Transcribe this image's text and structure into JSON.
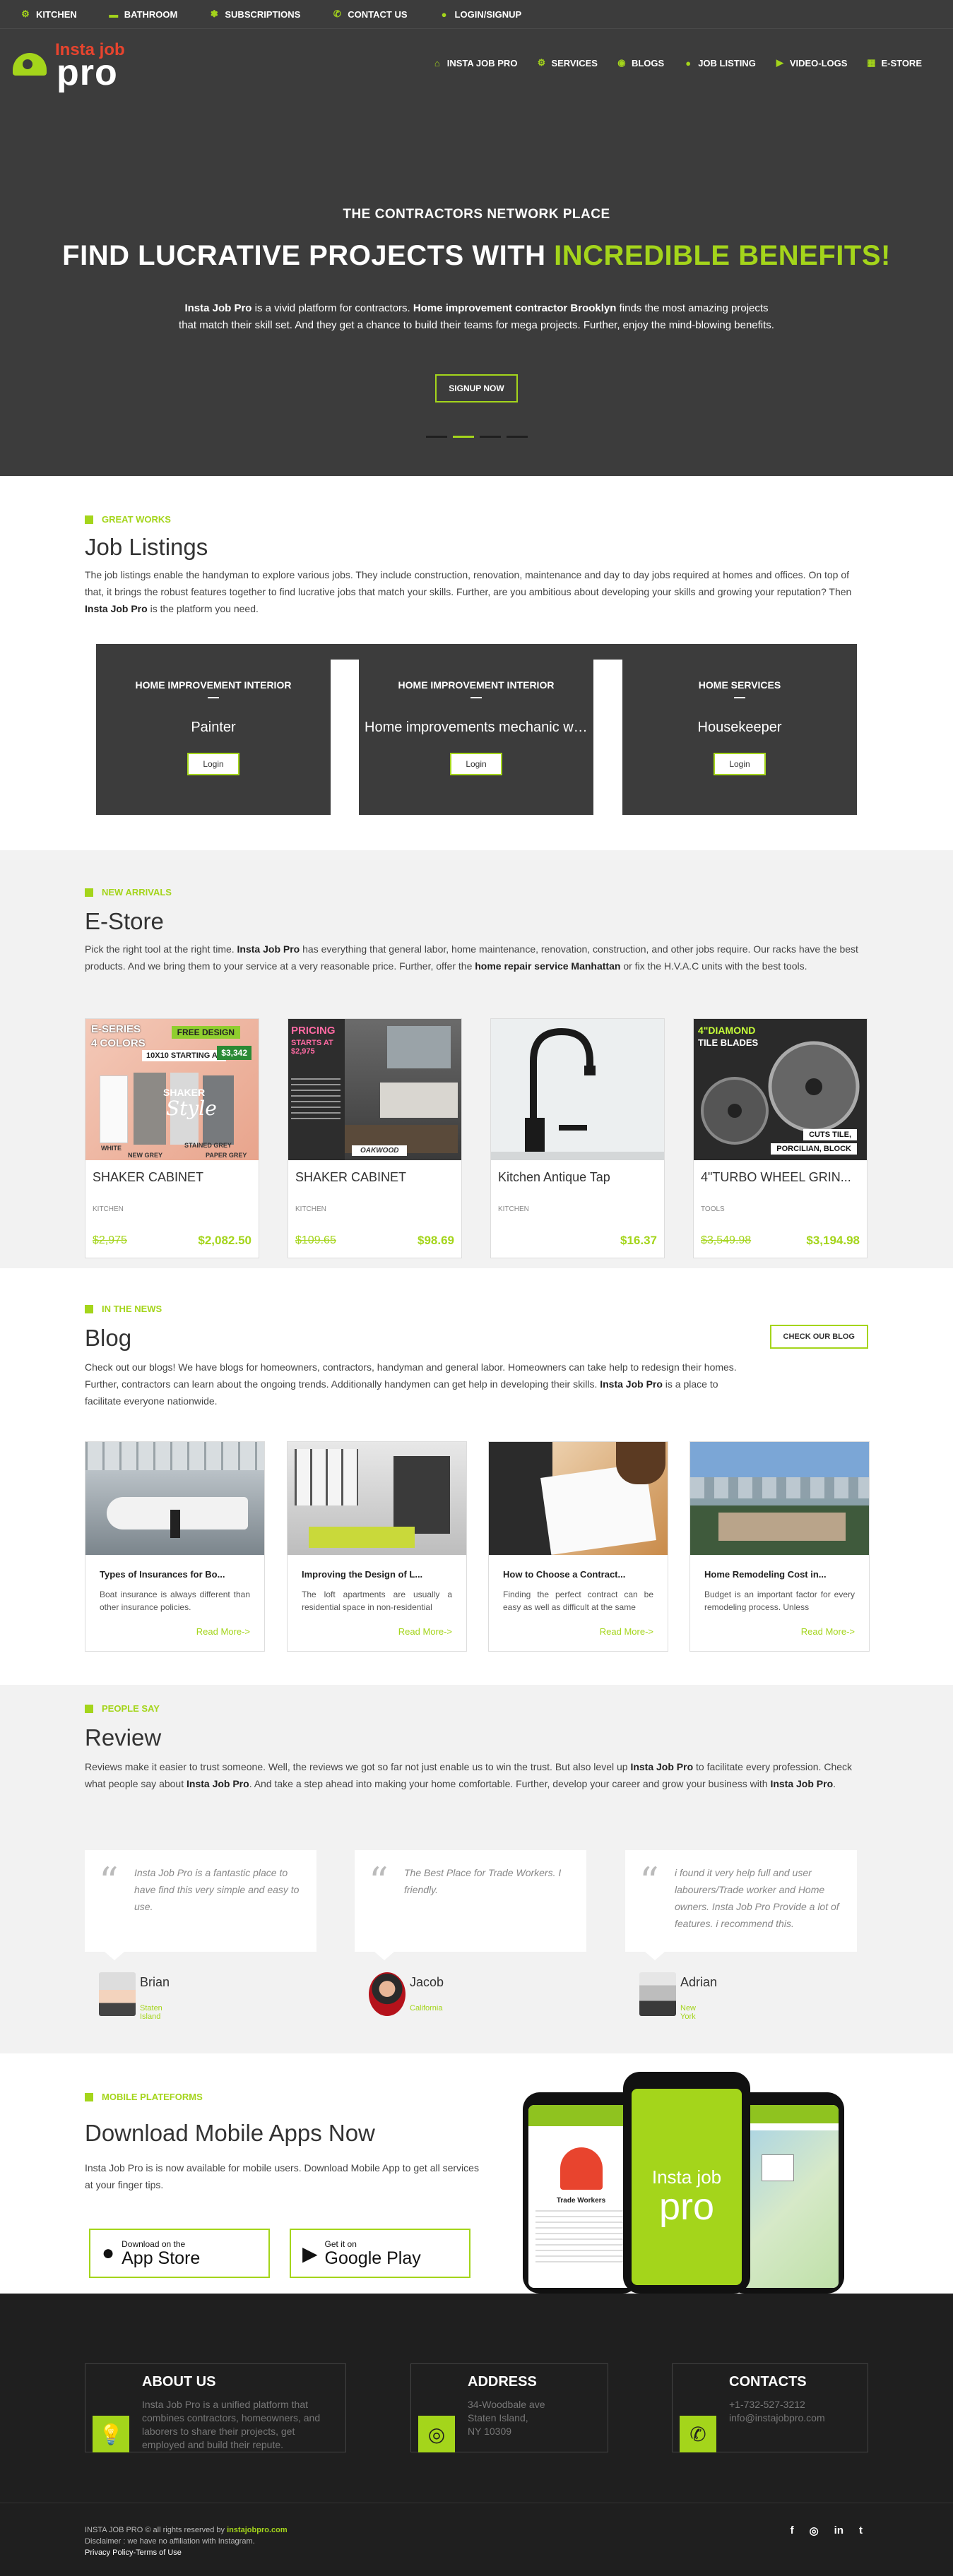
{
  "topbar": {
    "items": [
      {
        "label": "KITCHEN",
        "icon": "gear-icon"
      },
      {
        "label": "BATHROOM",
        "icon": "bath-icon"
      },
      {
        "label": "SUBSCRIPTIONS",
        "icon": "bell-icon"
      },
      {
        "label": "CONTACT US",
        "icon": "phone-icon"
      },
      {
        "label": "LOGIN/SIGNUP",
        "icon": "user-icon"
      }
    ]
  },
  "logo": {
    "line1": "Insta job",
    "line2": "pro"
  },
  "nav": {
    "items": [
      {
        "label": "INSTA JOB PRO",
        "icon": "home-icon"
      },
      {
        "label": "SERVICES",
        "icon": "gear-icon"
      },
      {
        "label": "BLOGS",
        "icon": "chat-icon"
      },
      {
        "label": "JOB LISTING",
        "icon": "user-icon"
      },
      {
        "label": "VIDEO-LOGS",
        "icon": "video-icon"
      },
      {
        "label": "E-STORE",
        "icon": "store-icon"
      }
    ]
  },
  "hero": {
    "kicker": "THE CONTRACTORS NETWORK PLACE",
    "title_a": "FIND LUCRATIVE PROJECTS WITH ",
    "title_b": "INCREDIBLE BENEFITS!",
    "d1": "Insta Job Pro",
    "d2": " is a vivid platform for contractors. ",
    "d3": "Home improvement contractor Brooklyn",
    "d4": " finds the most amazing projects that match their skill set. And they get a chance to build their teams for mega projects. Further, enjoy the mind-blowing benefits.",
    "cta": "SIGNUP NOW"
  },
  "jobs": {
    "eyebrow": "GREAT WORKS",
    "title": "Job Listings",
    "p1": "The job listings enable the handyman to explore various jobs. They include construction, renovation, maintenance and day to day jobs required at homes and offices. On top of that, it brings the robust features together to find lucrative jobs that match your skills. Further, are you ambitious about developing your skills and growing your reputation? Then ",
    "p2": "Insta Job Pro",
    "p3": " is the platform you need.",
    "cards": [
      {
        "category": "HOME IMPROVEMENT INTERIOR",
        "title": "Painter",
        "button": "Login"
      },
      {
        "category": "HOME IMPROVEMENT INTERIOR",
        "title": "Home improvements mechanic wa...",
        "button": "Login"
      },
      {
        "category": "HOME SERVICES",
        "title": "Housekeeper",
        "button": "Login"
      }
    ]
  },
  "store": {
    "eyebrow": "New Arrivals",
    "title": "E-Store",
    "p1": "Pick the right tool at the right time. ",
    "p2": "Insta Job Pro",
    "p3": " has everything that general labor, home maintenance, renovation, construction, and other jobs require. Our racks have the best products. And we bring them to your service at a very reasonable price. Further, offer the ",
    "p4": "home repair service Manhattan",
    "p5": " or fix the H.V.A.C units with the best tools.",
    "products": [
      {
        "name": "SHAKER CABINET",
        "category": "KITCHEN",
        "old": "$2,975",
        "price": "$2,082.50",
        "img": {
          "t1": "E-SERIES",
          "t2": "4 COLORS",
          "t3": "FREE DESIGN",
          "t4": "10X10 STARTING AT",
          "t5": "$3,342",
          "t6": "SHAKER",
          "t7": "Style",
          "t8": "WHITE",
          "t9": "STAINED GREY",
          "t10": "NEW GREY",
          "t11": "PAPER GREY"
        }
      },
      {
        "name": "SHAKER CABINET",
        "category": "KITCHEN",
        "old": "$109.65",
        "price": "$98.69",
        "img": {
          "t1": "PRICING",
          "t2": "STARTS AT $2,975",
          "t3": "OAKWOOD"
        }
      },
      {
        "name": "Kitchen Antique Tap",
        "category": "KITCHEN",
        "old": "",
        "price": "$16.37"
      },
      {
        "name": "4\"TURBO WHEEL GRIN...",
        "category": "TOOLS",
        "old": "$3,549.98",
        "price": "$3,194.98",
        "img": {
          "t1": "4\"DIAMOND",
          "t2": "TILE BLADES",
          "t3": "CUTS TILE,",
          "t4": "PORCILIAN, BLOCK"
        }
      }
    ]
  },
  "blog": {
    "eyebrow": "IN THE NEWS",
    "title": "Blog",
    "button": "CHECK OUR BLOG",
    "p1": "Check out our blogs! We have blogs for homeowners, contractors, handyman and general labor. Homeowners can take help to redesign their homes. Further, contractors can learn about the ongoing trends. Additionally handymen can get help in developing their skills. ",
    "p2": "Insta Job Pro",
    "p3": " is a place to facilitate everyone nationwide.",
    "posts": [
      {
        "title": "Types of Insurances for Bo...",
        "excerpt": "Boat insurance is always different than other insurance policies.",
        "more": "Read More->"
      },
      {
        "title": "Improving the Design of L...",
        "excerpt": "The loft apartments are usually a residential space in non-residential",
        "more": "Read More->"
      },
      {
        "title": "How to Choose a Contract...",
        "excerpt": "Finding the perfect contract can be easy as well as difficult at the same",
        "more": "Read More->"
      },
      {
        "title": "Home Remodeling Cost in...",
        "excerpt": "Budget is an important factor for every remodeling process. Unless",
        "more": "Read More->"
      }
    ]
  },
  "review": {
    "eyebrow": "PEOPLE SAY",
    "title": "Review",
    "p1": "Reviews make it easier to trust someone. Well, the reviews we got so far not just enable us to win the trust. But also level up ",
    "p2": "Insta Job Pro",
    "p3": " to facilitate every profession. Check what people say about ",
    "p4": "Insta Job Pro",
    "p5": ". And take a step ahead into making your home comfortable. Further, develop your career and grow your business with ",
    "p6": "Insta Job Pro",
    "p7": ".",
    "items": [
      {
        "text": "Insta Job Pro is a fantastic place to have find this very simple and easy to use.",
        "name": "Brian",
        "location": "Staten Island"
      },
      {
        "text": "The Best Place for Trade Workers. I friendly.",
        "name": "Jacob",
        "location": "California"
      },
      {
        "text": "i found it very help full and user labourers/Trade worker and Home owners. Insta Job Pro Provide a lot of features. i recommend this.",
        "name": "Adrian",
        "location": "New York"
      }
    ]
  },
  "mobile": {
    "eyebrow": "Mobile Plateforms",
    "title": "Download Mobile Apps Now",
    "text": "Insta Job Pro is is now available for mobile users. Download Mobile App to get all services at your finger tips.",
    "appstore_small": "Download on the",
    "appstore_big": "App Store",
    "play_small": "Get it on",
    "play_big": "Google Play",
    "phone_logo1": "Insta job",
    "phone_logo2": "pro",
    "phone_left": "Trade Workers"
  },
  "footer": {
    "about_title": "ABOUT US",
    "about_text": "Insta Job Pro is a unified platform that combines contractors, homeowners, and laborers to share their projects, get employed and build their repute.",
    "address_title": "ADDRESS",
    "address_lines": [
      "34-Woodbale ave",
      "Staten Island,",
      "NY 10309"
    ],
    "contacts_title": "CONTACTS",
    "contacts_lines": [
      "+1-732-527-3212",
      "info@instajobpro.com"
    ],
    "copy1": "INSTA JOB PRO © all rights reserved by ",
    "copy_link": "instajobpro.com",
    "copy2": "Disclaimer : we have no affiliation with Instagram.",
    "copy3": "Privacy Policy-Terms of Use",
    "social": [
      "f",
      "◎",
      "in",
      "t"
    ]
  },
  "colors": {
    "accent": "#a4d51b",
    "dark": "#3c3c3c",
    "footer": "#1f1f1f"
  }
}
